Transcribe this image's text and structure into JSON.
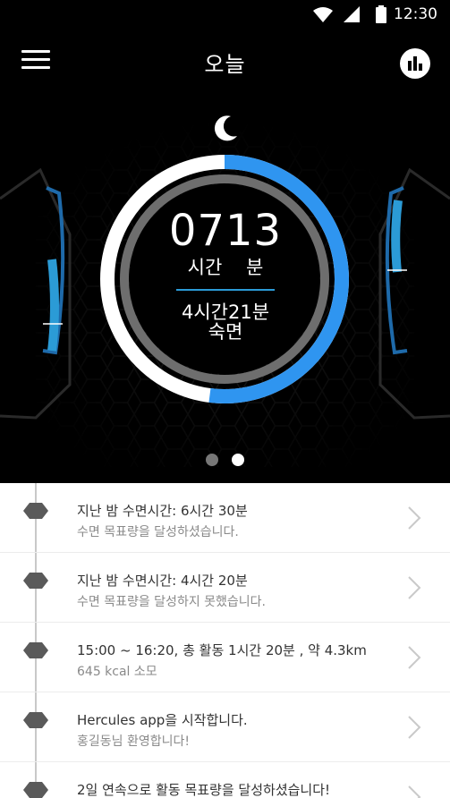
{
  "status_bar": {
    "time": "12:30",
    "icons": [
      "wifi-icon",
      "signal-icon",
      "battery-icon"
    ]
  },
  "app_bar": {
    "title": "오늘",
    "left_icon": "menu-icon",
    "right_icon": "stats-icon"
  },
  "dial": {
    "icon": "moon-icon",
    "time_value": "0713",
    "units": "시간 분",
    "duration": "4시간21분",
    "label": "숙면",
    "progress": 0.52,
    "colors": {
      "progress": "#2f95f0",
      "base": "#ffffff",
      "inner_ring": "#6e6e6e",
      "accent": "#2b9bd6"
    }
  },
  "pager": {
    "count": 2,
    "active": 1
  },
  "timeline": [
    {
      "title": "지난 밤 수면시간: 6시간 30분",
      "subtitle": "수면 목표량을 달성하셨습니다."
    },
    {
      "title": "지난 밤 수면시간: 4시간 20분",
      "subtitle": "수면 목표량을 달성하지 못했습니다."
    },
    {
      "title": "15:00 ~ 16:20, 총 활동 1시간 20분 , 약 4.3km",
      "subtitle": "645 kcal 소모"
    },
    {
      "title": "Hercules app을 시작합니다.",
      "subtitle": "홍길동님 환영합니다!"
    },
    {
      "title": "2일 연속으로 활동 목표량을 달성하셨습니다!",
      "subtitle": ""
    }
  ]
}
